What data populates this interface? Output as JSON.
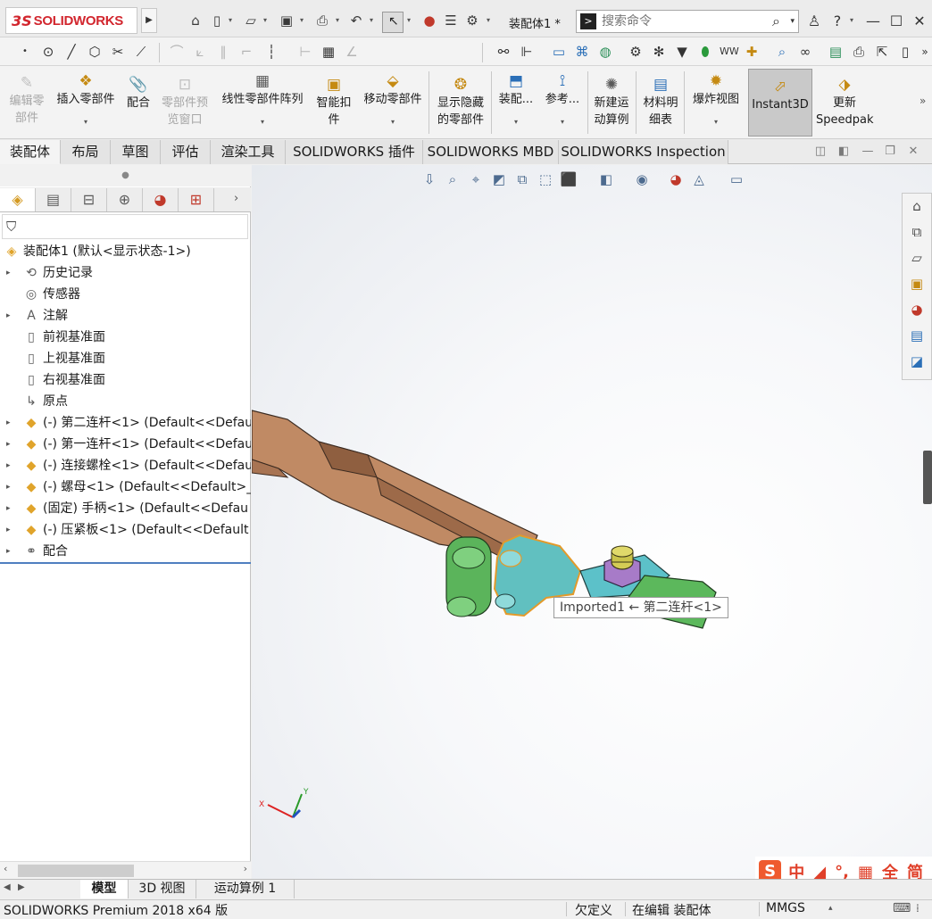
{
  "app": {
    "logo_ds": "3S",
    "logo_text": "SOLIDWORKS",
    "doc_title": "装配体1 *",
    "search_placeholder": "搜索命令"
  },
  "command_manager": {
    "edit_component": [
      "编辑零",
      "部件"
    ],
    "insert_components": "插入零部件",
    "mate": "配合",
    "component_preview": [
      "零部件预",
      "览窗口"
    ],
    "linear_pattern": "线性零部件阵列",
    "smart_fasteners": [
      "智能扣",
      "件"
    ],
    "move_component": "移动零部件",
    "show_hidden": [
      "显示隐藏",
      "的零部件"
    ],
    "assembly_features": "装配...",
    "reference": "参考...",
    "new_motion_study": [
      "新建运",
      "动算例"
    ],
    "bill_of_materials": [
      "材料明",
      "细表"
    ],
    "exploded_view": "爆炸视图",
    "instant3d": "Instant3D",
    "update_speedpak": [
      "更新",
      "Speedpak"
    ]
  },
  "tabs": [
    "装配体",
    "布局",
    "草图",
    "评估",
    "渲染工具",
    "SOLIDWORKS 插件",
    "SOLIDWORKS MBD",
    "SOLIDWORKS Inspection"
  ],
  "tree": {
    "root": "装配体1 (默认<显示状态-1>)",
    "items": [
      {
        "label": "历史记录",
        "icon": "history-icon",
        "expand": true
      },
      {
        "label": "传感器",
        "icon": "sensor-icon",
        "expand": false
      },
      {
        "label": "注解",
        "icon": "annotation-icon",
        "expand": true
      },
      {
        "label": "前视基准面",
        "icon": "plane-icon",
        "expand": false
      },
      {
        "label": "上视基准面",
        "icon": "plane-icon",
        "expand": false
      },
      {
        "label": "右视基准面",
        "icon": "plane-icon",
        "expand": false
      },
      {
        "label": "原点",
        "icon": "origin-icon",
        "expand": false
      },
      {
        "label": "(-) 第二连杆<1> (Default<<Defau",
        "icon": "part-icon",
        "expand": true
      },
      {
        "label": "(-) 第一连杆<1> (Default<<Defau",
        "icon": "part-icon",
        "expand": true
      },
      {
        "label": "(-) 连接螺栓<1> (Default<<Defau",
        "icon": "part-icon",
        "expand": true
      },
      {
        "label": "(-) 螺母<1> (Default<<Default>_",
        "icon": "part-icon",
        "expand": true
      },
      {
        "label": "(固定) 手柄<1> (Default<<Defau",
        "icon": "part-icon",
        "expand": true
      },
      {
        "label": "(-) 压紧板<1> (Default<<Default",
        "icon": "part-icon",
        "expand": true
      },
      {
        "label": "配合",
        "icon": "mates-icon",
        "expand": true
      }
    ]
  },
  "viewport": {
    "tooltip": "Imported1 ← 第二连杆<1>",
    "triad_x": "X",
    "triad_y": "Y"
  },
  "ime": [
    "中",
    "◢",
    "°,",
    "▦",
    "全",
    "简"
  ],
  "bottom_tabs": [
    "模型",
    "3D 视图",
    "运动算例 1"
  ],
  "status": {
    "product": "SOLIDWORKS Premium 2018 x64 版",
    "defined": "欠定义",
    "editing": "在编辑 装配体",
    "units": "MMGS"
  },
  "colors": {
    "handle": "#b9805c",
    "link_green": "#5cb85c",
    "link_teal": "#5fbfbf",
    "nut": "#a77bc8",
    "bolt": "#c9c24a",
    "selection": "#e39a2a"
  }
}
